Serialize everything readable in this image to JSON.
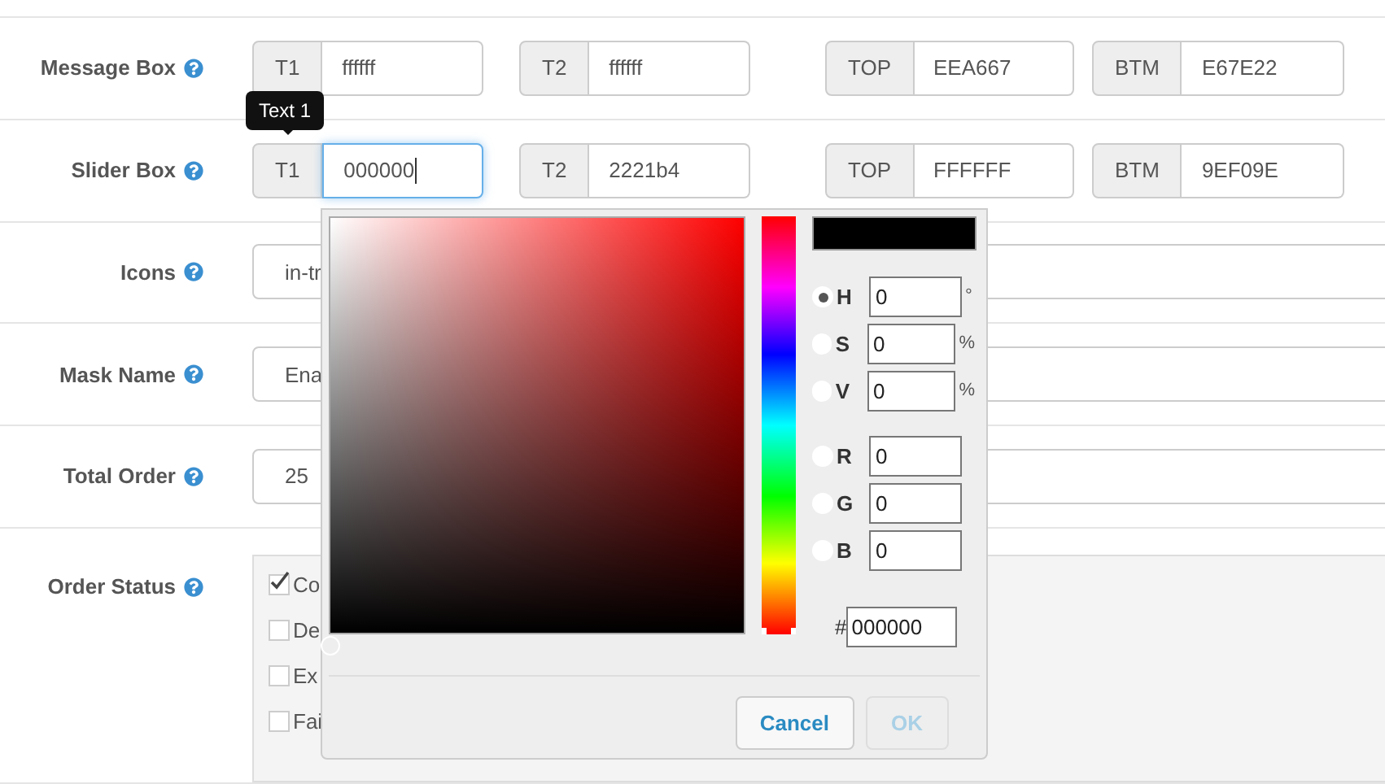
{
  "rows": [
    {
      "label": "Message Box",
      "kind": "colors",
      "groups": [
        {
          "addon": "T1",
          "value": "ffffff",
          "focused": false
        },
        {
          "addon": "T2",
          "value": "ffffff",
          "focused": false
        },
        {
          "addon": "TOP",
          "value": "EEA667",
          "focused": false
        },
        {
          "addon": "BTM",
          "value": "E67E22",
          "focused": false
        }
      ]
    },
    {
      "label": "Slider Box",
      "kind": "colors",
      "tooltip": "Text 1",
      "groups": [
        {
          "addon": "T1",
          "value": "000000",
          "focused": true
        },
        {
          "addon": "T2",
          "value": "2221b4",
          "focused": false
        },
        {
          "addon": "TOP",
          "value": "FFFFFF",
          "focused": false
        },
        {
          "addon": "BTM",
          "value": "9EF09E",
          "focused": false
        }
      ]
    },
    {
      "label": "Icons",
      "kind": "text",
      "value": "in-tr"
    },
    {
      "label": "Mask Name",
      "kind": "text",
      "value": "Ena"
    },
    {
      "label": "Total Order",
      "kind": "text",
      "value": "25"
    },
    {
      "label": "Order Status",
      "kind": "checks",
      "options": [
        {
          "label": "Co",
          "checked": true
        },
        {
          "label": "De",
          "checked": false
        },
        {
          "label": "Ex",
          "checked": false
        },
        {
          "label": "Fai",
          "checked": false
        }
      ]
    }
  ],
  "color_picker": {
    "hue": {
      "level": 0
    },
    "fields": [
      {
        "label": "H",
        "value": "0",
        "unit": "°",
        "selected": true
      },
      {
        "label": "S",
        "value": "0",
        "unit": "%",
        "selected": false
      },
      {
        "label": "V",
        "value": "0",
        "unit": "%",
        "selected": false
      },
      {
        "label": "R",
        "value": "0",
        "selected": false
      },
      {
        "label": "G",
        "value": "0",
        "selected": false
      },
      {
        "label": "B",
        "value": "0",
        "selected": false
      }
    ],
    "hash": "#",
    "hex": "000000",
    "cancel": "Cancel",
    "ok": {
      "label": "OK",
      "disabled": true
    }
  }
}
